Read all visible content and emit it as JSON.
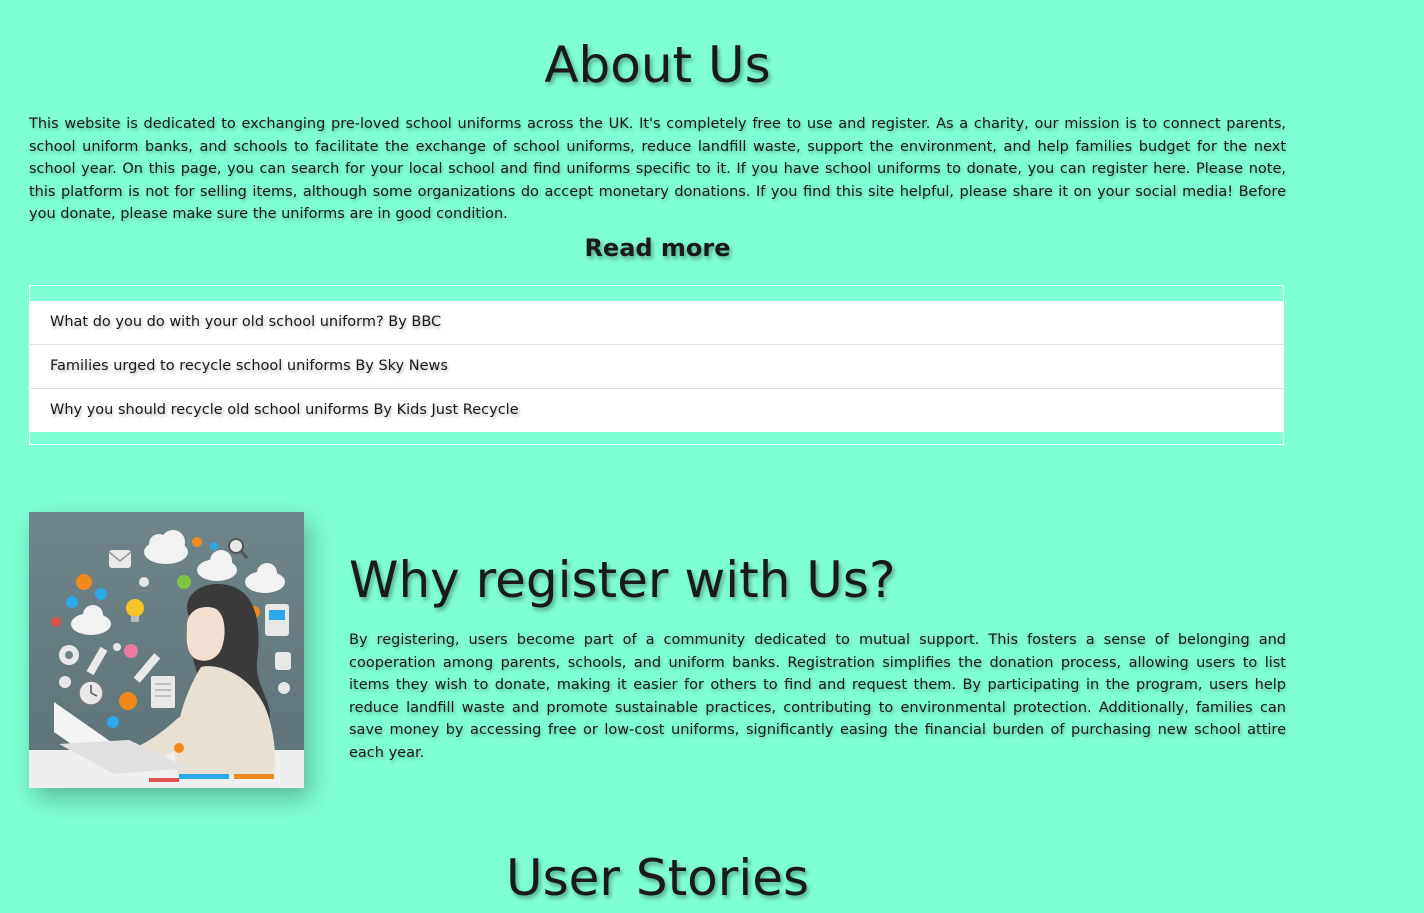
{
  "about": {
    "title": "About Us",
    "text": "This website is dedicated to exchanging pre-loved school uniforms across the UK. It's completely free to use and register. As a charity, our mission is to connect parents, school uniform banks, and schools to facilitate the exchange of school uniforms, reduce landfill waste, support the environment, and help families budget for the next school year. On this page, you can search for your local school and find uniforms specific to it. If you have school uniforms to donate, you can register here. Please note, this platform is not for selling items, although some organizations do accept monetary donations. If you find this site helpful, please share it on your social media! Before you donate, please make sure the uniforms are in good condition."
  },
  "read_more": {
    "title": "Read more",
    "links": [
      "What do you do with your old school uniform? By BBC",
      "Families urged to recycle school uniforms By Sky News",
      "Why you should recycle old school uniforms By Kids Just Recycle"
    ]
  },
  "why": {
    "title": "Why register with Us?",
    "text": "By registering, users become part of a community dedicated to mutual support. This fosters a sense of belonging and cooperation among parents, schools, and uniform banks. Registration simplifies the donation process, allowing users to list items they wish to donate, making it easier for others to find and request them. By participating in the program, users help reduce landfill waste and promote sustainable practices, contributing to environmental protection. Additionally, families can save money by accessing free or low-cost uniforms, significantly easing the financial burden of purchasing new school attire each year."
  },
  "stories": {
    "title": "User Stories"
  },
  "colors": {
    "background": "#7fffd4",
    "list_bg": "#ffffff",
    "text": "#1a1a1a"
  },
  "image": {
    "subject": "illustration of woman working on laptop surrounded by icons"
  }
}
